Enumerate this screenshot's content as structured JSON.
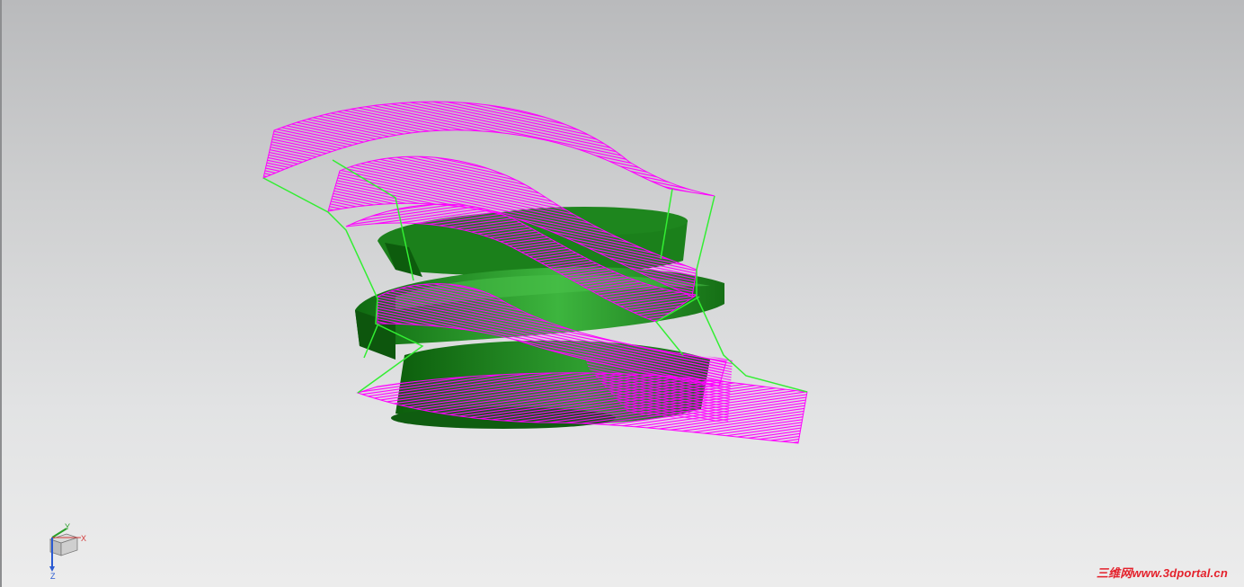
{
  "viewport": {
    "name": "3D graphics window",
    "background_top": "#b9babc",
    "background_bottom": "#ececec"
  },
  "model": {
    "solid_color": "#1c8a1c",
    "solid_highlight": "#3fb83f",
    "toolpath_color": "#ff00ff",
    "wire_color": "#33ee33"
  },
  "triad": {
    "x_label": "X",
    "y_label": "Y",
    "z_label": "Z",
    "x_color": "#d23a3a",
    "y_color": "#2aa02a",
    "z_color": "#2a5ad2"
  },
  "watermark": {
    "text": "三维网www.3dportal.cn"
  }
}
